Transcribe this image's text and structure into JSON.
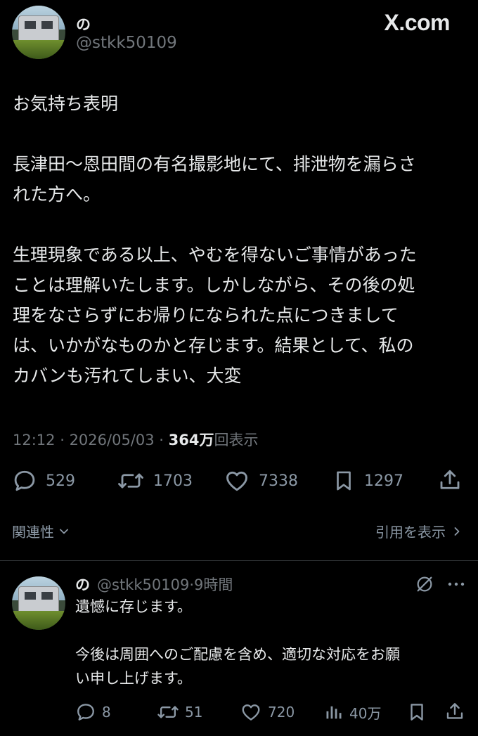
{
  "header": {
    "display_name": "の",
    "handle": "@stkk50109",
    "brand": "X.com"
  },
  "tweet": {
    "paragraphs": [
      "お気持ち表明",
      "長津田〜恩田間の有名撮影地にて、排泄物を漏らさ\nれた方へ。",
      "生理現象である以上、やむを得ないご事情があった\nことは理解いたします。しかしながら、その後の処\n理をなさらずにお帰りになられた点につきまして\nは、いかがなものかと存じます。結果として、私の\nカバンも汚れてしまい、大変"
    ],
    "time": "12:12",
    "date": "2026/05/03",
    "views_count": "364",
    "views_unit": "万",
    "views_label": "回表示",
    "replies": "529",
    "reposts": "1703",
    "likes": "7338",
    "bookmarks": "1297",
    "relevance_label": "関連性",
    "quotes_label": "引用を表示"
  },
  "reply": {
    "display_name": "の",
    "handle": "@stkk50109",
    "time_ago": "9時間",
    "paragraphs": [
      "遺憾に存じます。",
      "今後は周囲へのご配慮を含め、適切な対応をお願\nい申し上げます。"
    ],
    "replies": "8",
    "reposts": "51",
    "likes": "720",
    "views": "40万"
  },
  "colors": {
    "background": "#000000",
    "text": "#e7e9ea",
    "muted": "#71767b",
    "divider": "#2f3336"
  }
}
